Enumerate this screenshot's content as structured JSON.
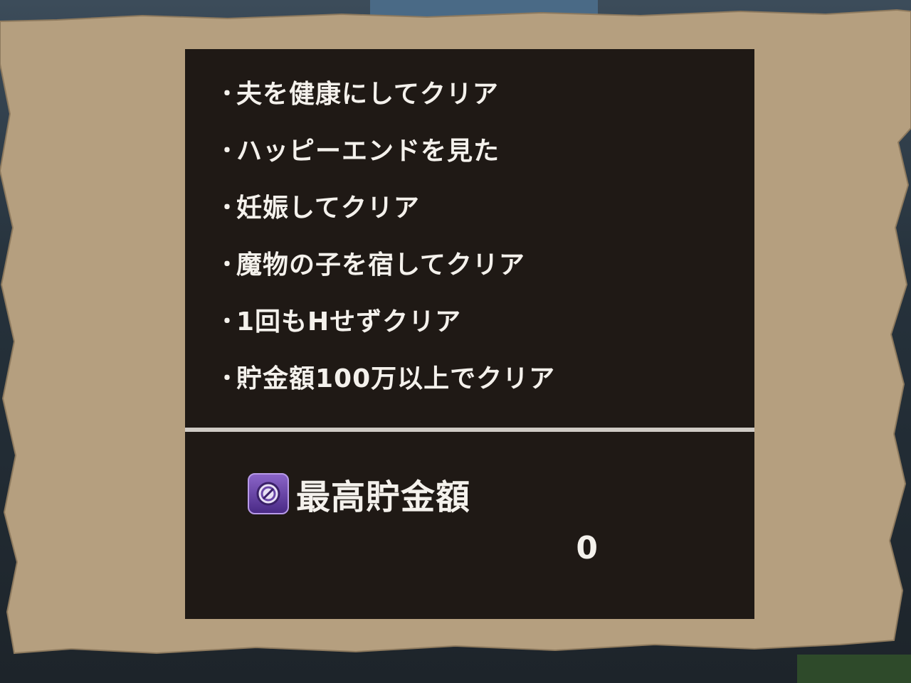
{
  "clear_conditions": [
    {
      "bullet": "・",
      "label": "夫を健康にしてクリア"
    },
    {
      "bullet": "・",
      "label": "ハッピーエンドを見た"
    },
    {
      "bullet": "・",
      "label": "妊娠してクリア"
    },
    {
      "bullet": "・",
      "label": "魔物の子を宿してクリア"
    },
    {
      "bullet": "・",
      "label": "1回もHせずクリア"
    },
    {
      "bullet": "・",
      "label": "貯金額100万以上でクリア"
    }
  ],
  "savings_record": {
    "icon": "medal-icon",
    "title": "最高貯金額",
    "value": "0"
  },
  "colors": {
    "parchment": "#b59f7f",
    "panel": "#1f1915",
    "text": "#f4f1ec",
    "divider": "#cfcac4",
    "icon_accent": "#6a46a8"
  }
}
